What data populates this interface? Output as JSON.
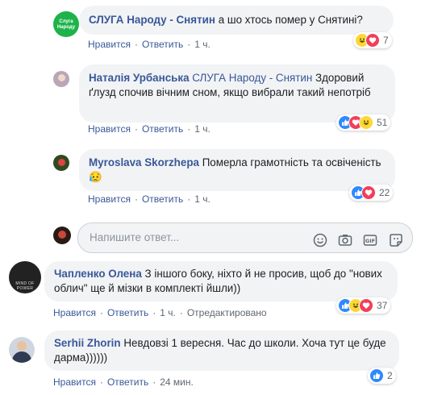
{
  "actions": {
    "like": "Нравится",
    "reply": "Ответить",
    "sep": "·",
    "edited": "Отредактировано"
  },
  "comments": [
    {
      "author": "СЛУГА Народу - Снятин",
      "text": "а шо хтось помер у Снятині?",
      "time": "1 ч.",
      "count": "7",
      "reactions": [
        "haha-icon",
        "love-icon"
      ],
      "avatar_text": "Слуга Народу"
    },
    {
      "author": "Наталія Урбанська",
      "mention": "СЛУГА Народу - Снятин",
      "text": "Здоровий ґлузд спочив вічним сном, якщо вибрали такий непотріб",
      "time": "1 ч.",
      "count": "51",
      "reactions": [
        "like-icon",
        "love-icon",
        "haha-icon"
      ]
    },
    {
      "author": "Myroslava Skorzhepa",
      "text": "Померла грамотність та освіченість😥",
      "time": "1 ч.",
      "count": "22",
      "reactions": [
        "like-icon",
        "love-icon"
      ]
    },
    {
      "author": "Чапленко Олена",
      "text": "З іншого боку, ніхто й не просив, щоб до \"нових облич\" ще й мізки в комплекті йшли))",
      "time": "1 ч.",
      "count": "37",
      "reactions": [
        "like-icon",
        "haha-icon",
        "love-icon"
      ],
      "avatar_text": "MIND OF POWER"
    },
    {
      "author": "Serhii Zhorin",
      "text": "Невдовзі 1 вересня. Час до школи. Хоча тут це буде дарма))))))",
      "time": "24 мин.",
      "count": "2",
      "reactions": [
        "like-icon"
      ]
    }
  ],
  "reply_input": {
    "placeholder": "Напишите ответ..."
  },
  "toolbar_icons": [
    "emoji-icon",
    "camera-icon",
    "gif-icon",
    "sticker-icon"
  ],
  "colors": {
    "link": "#385898",
    "bubble": "#f2f3f5",
    "muted": "#606770",
    "like": "#2e89ff",
    "love": "#f33e58",
    "haha": "#fdd835"
  }
}
